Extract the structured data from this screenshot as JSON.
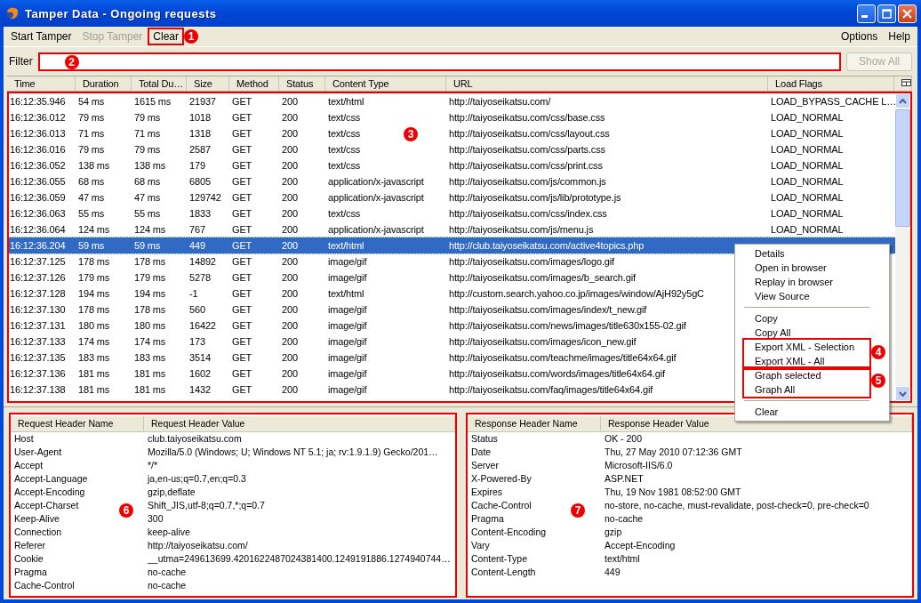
{
  "window": {
    "title": "Tamper Data - Ongoing requests"
  },
  "menu_bar": {
    "left": [
      {
        "label": "Start Tamper",
        "disabled": false
      },
      {
        "label": "Stop Tamper",
        "disabled": true
      },
      {
        "label": "Clear",
        "disabled": false,
        "callout": "1"
      }
    ],
    "right": [
      {
        "label": "Options",
        "disabled": false
      },
      {
        "label": "Help",
        "disabled": false
      }
    ]
  },
  "filter": {
    "label": "Filter",
    "callout": "2",
    "button": {
      "label": "Show All",
      "disabled": true
    }
  },
  "requests": {
    "callout": "3",
    "columns": [
      "Time",
      "Duration",
      "Total Du…",
      "Size",
      "Method",
      "Status",
      "Content Type",
      "URL",
      "Load Flags"
    ],
    "rows": [
      {
        "selected": false,
        "cells": [
          "16:12:35.946",
          "54 ms",
          "1615 ms",
          "21937",
          "GET",
          "200",
          "text/html",
          "http://taiyoseikatsu.com/",
          "LOAD_BYPASS_CACHE  L…"
        ]
      },
      {
        "selected": false,
        "cells": [
          "16:12:36.012",
          "79 ms",
          "79 ms",
          "1018",
          "GET",
          "200",
          "text/css",
          "http://taiyoseikatsu.com/css/base.css",
          "LOAD_NORMAL"
        ]
      },
      {
        "selected": false,
        "cells": [
          "16:12:36.013",
          "71 ms",
          "71 ms",
          "1318",
          "GET",
          "200",
          "text/css",
          "http://taiyoseikatsu.com/css/layout.css",
          "LOAD_NORMAL"
        ]
      },
      {
        "selected": false,
        "cells": [
          "16:12:36.016",
          "79 ms",
          "79 ms",
          "2587",
          "GET",
          "200",
          "text/css",
          "http://taiyoseikatsu.com/css/parts.css",
          "LOAD_NORMAL"
        ]
      },
      {
        "selected": false,
        "cells": [
          "16:12:36.052",
          "138 ms",
          "138 ms",
          "179",
          "GET",
          "200",
          "text/css",
          "http://taiyoseikatsu.com/css/print.css",
          "LOAD_NORMAL"
        ]
      },
      {
        "selected": false,
        "cells": [
          "16:12:36.055",
          "68 ms",
          "68 ms",
          "6805",
          "GET",
          "200",
          "application/x-javascript",
          "http://taiyoseikatsu.com/js/common.js",
          "LOAD_NORMAL"
        ]
      },
      {
        "selected": false,
        "cells": [
          "16:12:36.059",
          "47 ms",
          "47 ms",
          "129742",
          "GET",
          "200",
          "application/x-javascript",
          "http://taiyoseikatsu.com/js/lib/prototype.js",
          "LOAD_NORMAL"
        ]
      },
      {
        "selected": false,
        "cells": [
          "16:12:36.063",
          "55 ms",
          "55 ms",
          "1833",
          "GET",
          "200",
          "text/css",
          "http://taiyoseikatsu.com/css/index.css",
          "LOAD_NORMAL"
        ]
      },
      {
        "selected": false,
        "cells": [
          "16:12:36.064",
          "124 ms",
          "124 ms",
          "767",
          "GET",
          "200",
          "application/x-javascript",
          "http://taiyoseikatsu.com/js/menu.js",
          "LOAD_NORMAL"
        ]
      },
      {
        "selected": true,
        "cells": [
          "16:12:36.204",
          "59 ms",
          "59 ms",
          "449",
          "GET",
          "200",
          "text/html",
          "http://club.taiyoseikatsu.com/active4topics.php"
        ]
      },
      {
        "selected": false,
        "cells": [
          "16:12:37.125",
          "178 ms",
          "178 ms",
          "14892",
          "GET",
          "200",
          "image/gif",
          "http://taiyoseikatsu.com/images/logo.gif"
        ]
      },
      {
        "selected": false,
        "cells": [
          "16:12:37.126",
          "179 ms",
          "179 ms",
          "5278",
          "GET",
          "200",
          "image/gif",
          "http://taiyoseikatsu.com/images/b_search.gif"
        ]
      },
      {
        "selected": false,
        "cells": [
          "16:12:37.128",
          "194 ms",
          "194 ms",
          "-1",
          "GET",
          "200",
          "text/html",
          "http://custom.search.yahoo.co.jp/images/window/AjH92y5gC"
        ]
      },
      {
        "selected": false,
        "cells": [
          "16:12:37.130",
          "178 ms",
          "178 ms",
          "560",
          "GET",
          "200",
          "image/gif",
          "http://taiyoseikatsu.com/images/index/t_new.gif"
        ]
      },
      {
        "selected": false,
        "cells": [
          "16:12:37.131",
          "180 ms",
          "180 ms",
          "16422",
          "GET",
          "200",
          "image/gif",
          "http://taiyoseikatsu.com/news/images/title630x155-02.gif"
        ]
      },
      {
        "selected": false,
        "cells": [
          "16:12:37.133",
          "174 ms",
          "174 ms",
          "173",
          "GET",
          "200",
          "image/gif",
          "http://taiyoseikatsu.com/images/icon_new.gif"
        ]
      },
      {
        "selected": false,
        "cells": [
          "16:12:37.135",
          "183 ms",
          "183 ms",
          "3514",
          "GET",
          "200",
          "image/gif",
          "http://taiyoseikatsu.com/teachme/images/title64x64.gif"
        ]
      },
      {
        "selected": false,
        "cells": [
          "16:12:37.136",
          "181 ms",
          "181 ms",
          "1602",
          "GET",
          "200",
          "image/gif",
          "http://taiyoseikatsu.com/words/images/title64x64.gif"
        ]
      },
      {
        "selected": false,
        "cells": [
          "16:12:37.138",
          "181 ms",
          "181 ms",
          "1432",
          "GET",
          "200",
          "image/gif",
          "http://taiyoseikatsu.com/faq/images/title64x64.gif"
        ]
      }
    ]
  },
  "context_menu": {
    "sections": [
      {
        "separator_before": false,
        "items": [
          "Details",
          "Open in browser",
          "Replay in browser",
          "View Source"
        ]
      },
      {
        "separator_before": true,
        "items": [
          "Copy",
          "Copy All"
        ]
      },
      {
        "separator_before": false,
        "callout": "4",
        "items": [
          "Export XML - Selection",
          "Export XML - All"
        ]
      },
      {
        "separator_before": false,
        "callout": "5",
        "items": [
          "Graph selected",
          "Graph All"
        ]
      },
      {
        "separator_before": true,
        "items": [
          "Clear"
        ]
      }
    ]
  },
  "request_headers": {
    "callout": "6",
    "columns": [
      "Request Header Name",
      "Request Header Value"
    ],
    "rows": [
      [
        "Host",
        "club.taiyoseikatsu.com"
      ],
      [
        "User-Agent",
        "Mozilla/5.0 (Windows; U; Windows NT 5.1; ja; rv:1.9.1.9) Gecko/201…"
      ],
      [
        "Accept",
        "*/*"
      ],
      [
        "Accept-Language",
        "ja,en-us;q=0.7,en;q=0.3"
      ],
      [
        "Accept-Encoding",
        "gzip,deflate"
      ],
      [
        "Accept-Charset",
        "Shift_JIS,utf-8;q=0.7,*;q=0.7"
      ],
      [
        "Keep-Alive",
        "300"
      ],
      [
        "Connection",
        "keep-alive"
      ],
      [
        "Referer",
        "http://taiyoseikatsu.com/"
      ],
      [
        "Cookie",
        "__utma=249613699.4201622487024381400.1249191886.1274940744…"
      ],
      [
        "Pragma",
        "no-cache"
      ],
      [
        "Cache-Control",
        "no-cache"
      ]
    ]
  },
  "response_headers": {
    "callout": "7",
    "columns": [
      "Response Header Name",
      "Response Header Value"
    ],
    "rows": [
      [
        "Status",
        "OK - 200"
      ],
      [
        "Date",
        "Thu, 27 May 2010 07:12:36 GMT"
      ],
      [
        "Server",
        "Microsoft-IIS/6.0"
      ],
      [
        "X-Powered-By",
        "ASP.NET"
      ],
      [
        "Expires",
        "Thu, 19 Nov 1981 08:52:00 GMT"
      ],
      [
        "Cache-Control",
        "no-store, no-cache, must-revalidate, post-check=0, pre-check=0"
      ],
      [
        "Pragma",
        "no-cache"
      ],
      [
        "Content-Encoding",
        "gzip"
      ],
      [
        "Vary",
        "Accept-Encoding"
      ],
      [
        "Content-Type",
        "text/html"
      ],
      [
        "Content-Length",
        "449"
      ]
    ]
  }
}
